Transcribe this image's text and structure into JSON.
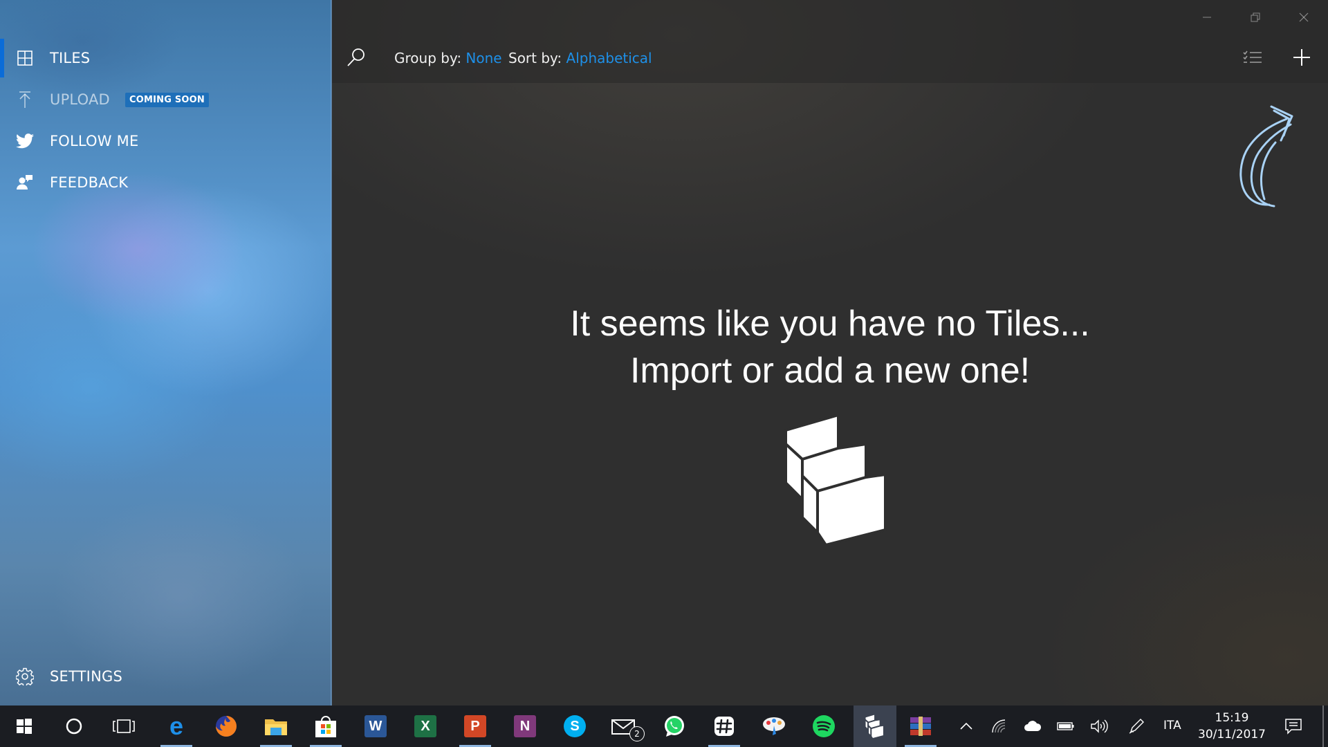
{
  "sidebar": {
    "items": [
      {
        "label": "TILES",
        "icon": "tiles-grid-icon",
        "selected": true
      },
      {
        "label": "UPLOAD",
        "icon": "upload-arrow-icon",
        "badge": "COMING SOON",
        "disabled": true
      },
      {
        "label": "FOLLOW ME",
        "icon": "twitter-bird-icon"
      },
      {
        "label": "FEEDBACK",
        "icon": "feedback-person-icon"
      }
    ],
    "settings_label": "SETTINGS"
  },
  "toolbar": {
    "group_by_label": "Group by:",
    "group_by_value": "None",
    "sort_by_label": "Sort by:",
    "sort_by_value": "Alphabetical"
  },
  "main": {
    "empty_line1": "It seems like you have no Tiles...",
    "empty_line2": "Import or add a new one!"
  },
  "taskbar": {
    "mail_badge": "2",
    "language": "ITA",
    "time": "15:19",
    "date": "30/11/2017"
  },
  "colors": {
    "accent": "#0a6cd8",
    "link": "#1e90e8",
    "badge": "#1e6fb9",
    "taskbar": "#1b1d22"
  }
}
